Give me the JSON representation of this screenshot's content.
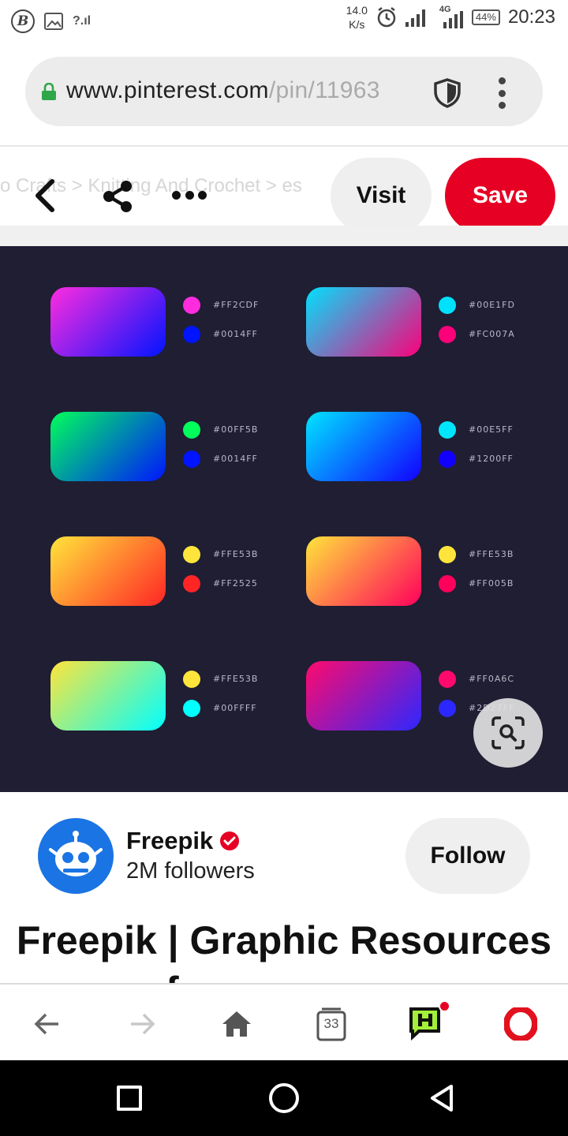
{
  "status_bar": {
    "left_icons": [
      "b-app-icon",
      "image-icon",
      "no-signal-icon"
    ],
    "speed_value": "14.0",
    "speed_unit": "K/s",
    "network": "4G",
    "battery": "44%",
    "time": "20:23"
  },
  "browser": {
    "url_host": "www.pinterest.com",
    "url_path": "/pin/11963",
    "tab_count": "33"
  },
  "pin_actions": {
    "breadcrumbs": "o Crafts  >  Knitting And Crochet  >  es",
    "visit_label": "Visit",
    "save_label": "Save"
  },
  "palette": [
    {
      "hex1": "#FF2CDF",
      "hex2": "#0014FF",
      "c1": "#ff2cdf",
      "c2": "#0014ff"
    },
    {
      "hex1": "#00E1FD",
      "hex2": "#FC007A",
      "c1": "#00e1fd",
      "c2": "#fc007a"
    },
    {
      "hex1": "#00FF5B",
      "hex2": "#0014FF",
      "c1": "#00ff5b",
      "c2": "#0014ff"
    },
    {
      "hex1": "#00E5FF",
      "hex2": "#1200FF",
      "c1": "#00e5ff",
      "c2": "#1200ff"
    },
    {
      "hex1": "#FFE53B",
      "hex2": "#FF2525",
      "c1": "#ffe53b",
      "c2": "#ff2525"
    },
    {
      "hex1": "#FFE53B",
      "hex2": "#FF005B",
      "c1": "#ffe53b",
      "c2": "#ff005b"
    },
    {
      "hex1": "#FFE53B",
      "hex2": "#00FFFF",
      "c1": "#ffe53b",
      "c2": "#00ffff"
    },
    {
      "hex1": "#FF0A6C",
      "hex2": "#2D27FF",
      "c1": "#ff0a6c",
      "c2": "#2d27ff"
    }
  ],
  "creator": {
    "name": "Freepik",
    "followers": "2M followers",
    "follow_label": "Follow"
  },
  "pin_title": "Freepik | Graphic Resources for everyone",
  "colors": {
    "save_red": "#e60023",
    "pin_background": "#1f1e33",
    "avatar_blue": "#1a74e4"
  }
}
